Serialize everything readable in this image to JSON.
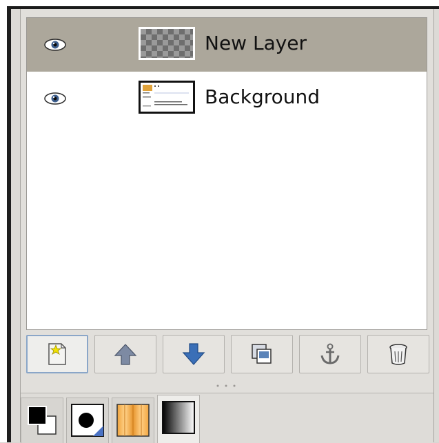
{
  "layers": [
    {
      "name": "New Layer",
      "selected": true,
      "visible": true,
      "thumbnail": "transparent-checker"
    },
    {
      "name": "Background",
      "selected": false,
      "visible": true,
      "thumbnail": "document-preview"
    }
  ],
  "toolbar": {
    "buttons": [
      {
        "icon": "new-layer-icon"
      },
      {
        "icon": "raise-layer-icon"
      },
      {
        "icon": "lower-layer-icon"
      },
      {
        "icon": "duplicate-layer-icon"
      },
      {
        "icon": "anchor-layer-icon"
      },
      {
        "icon": "delete-layer-icon"
      }
    ]
  },
  "dock_tabs": [
    {
      "icon": "fg-bg-colors-icon"
    },
    {
      "icon": "brush-icon"
    },
    {
      "icon": "pattern-icon"
    },
    {
      "icon": "gradient-icon"
    }
  ],
  "colors": {
    "selected_row": "#aca79b",
    "arrow_up": "#7d8aa3",
    "arrow_down": "#3a6fb7"
  }
}
